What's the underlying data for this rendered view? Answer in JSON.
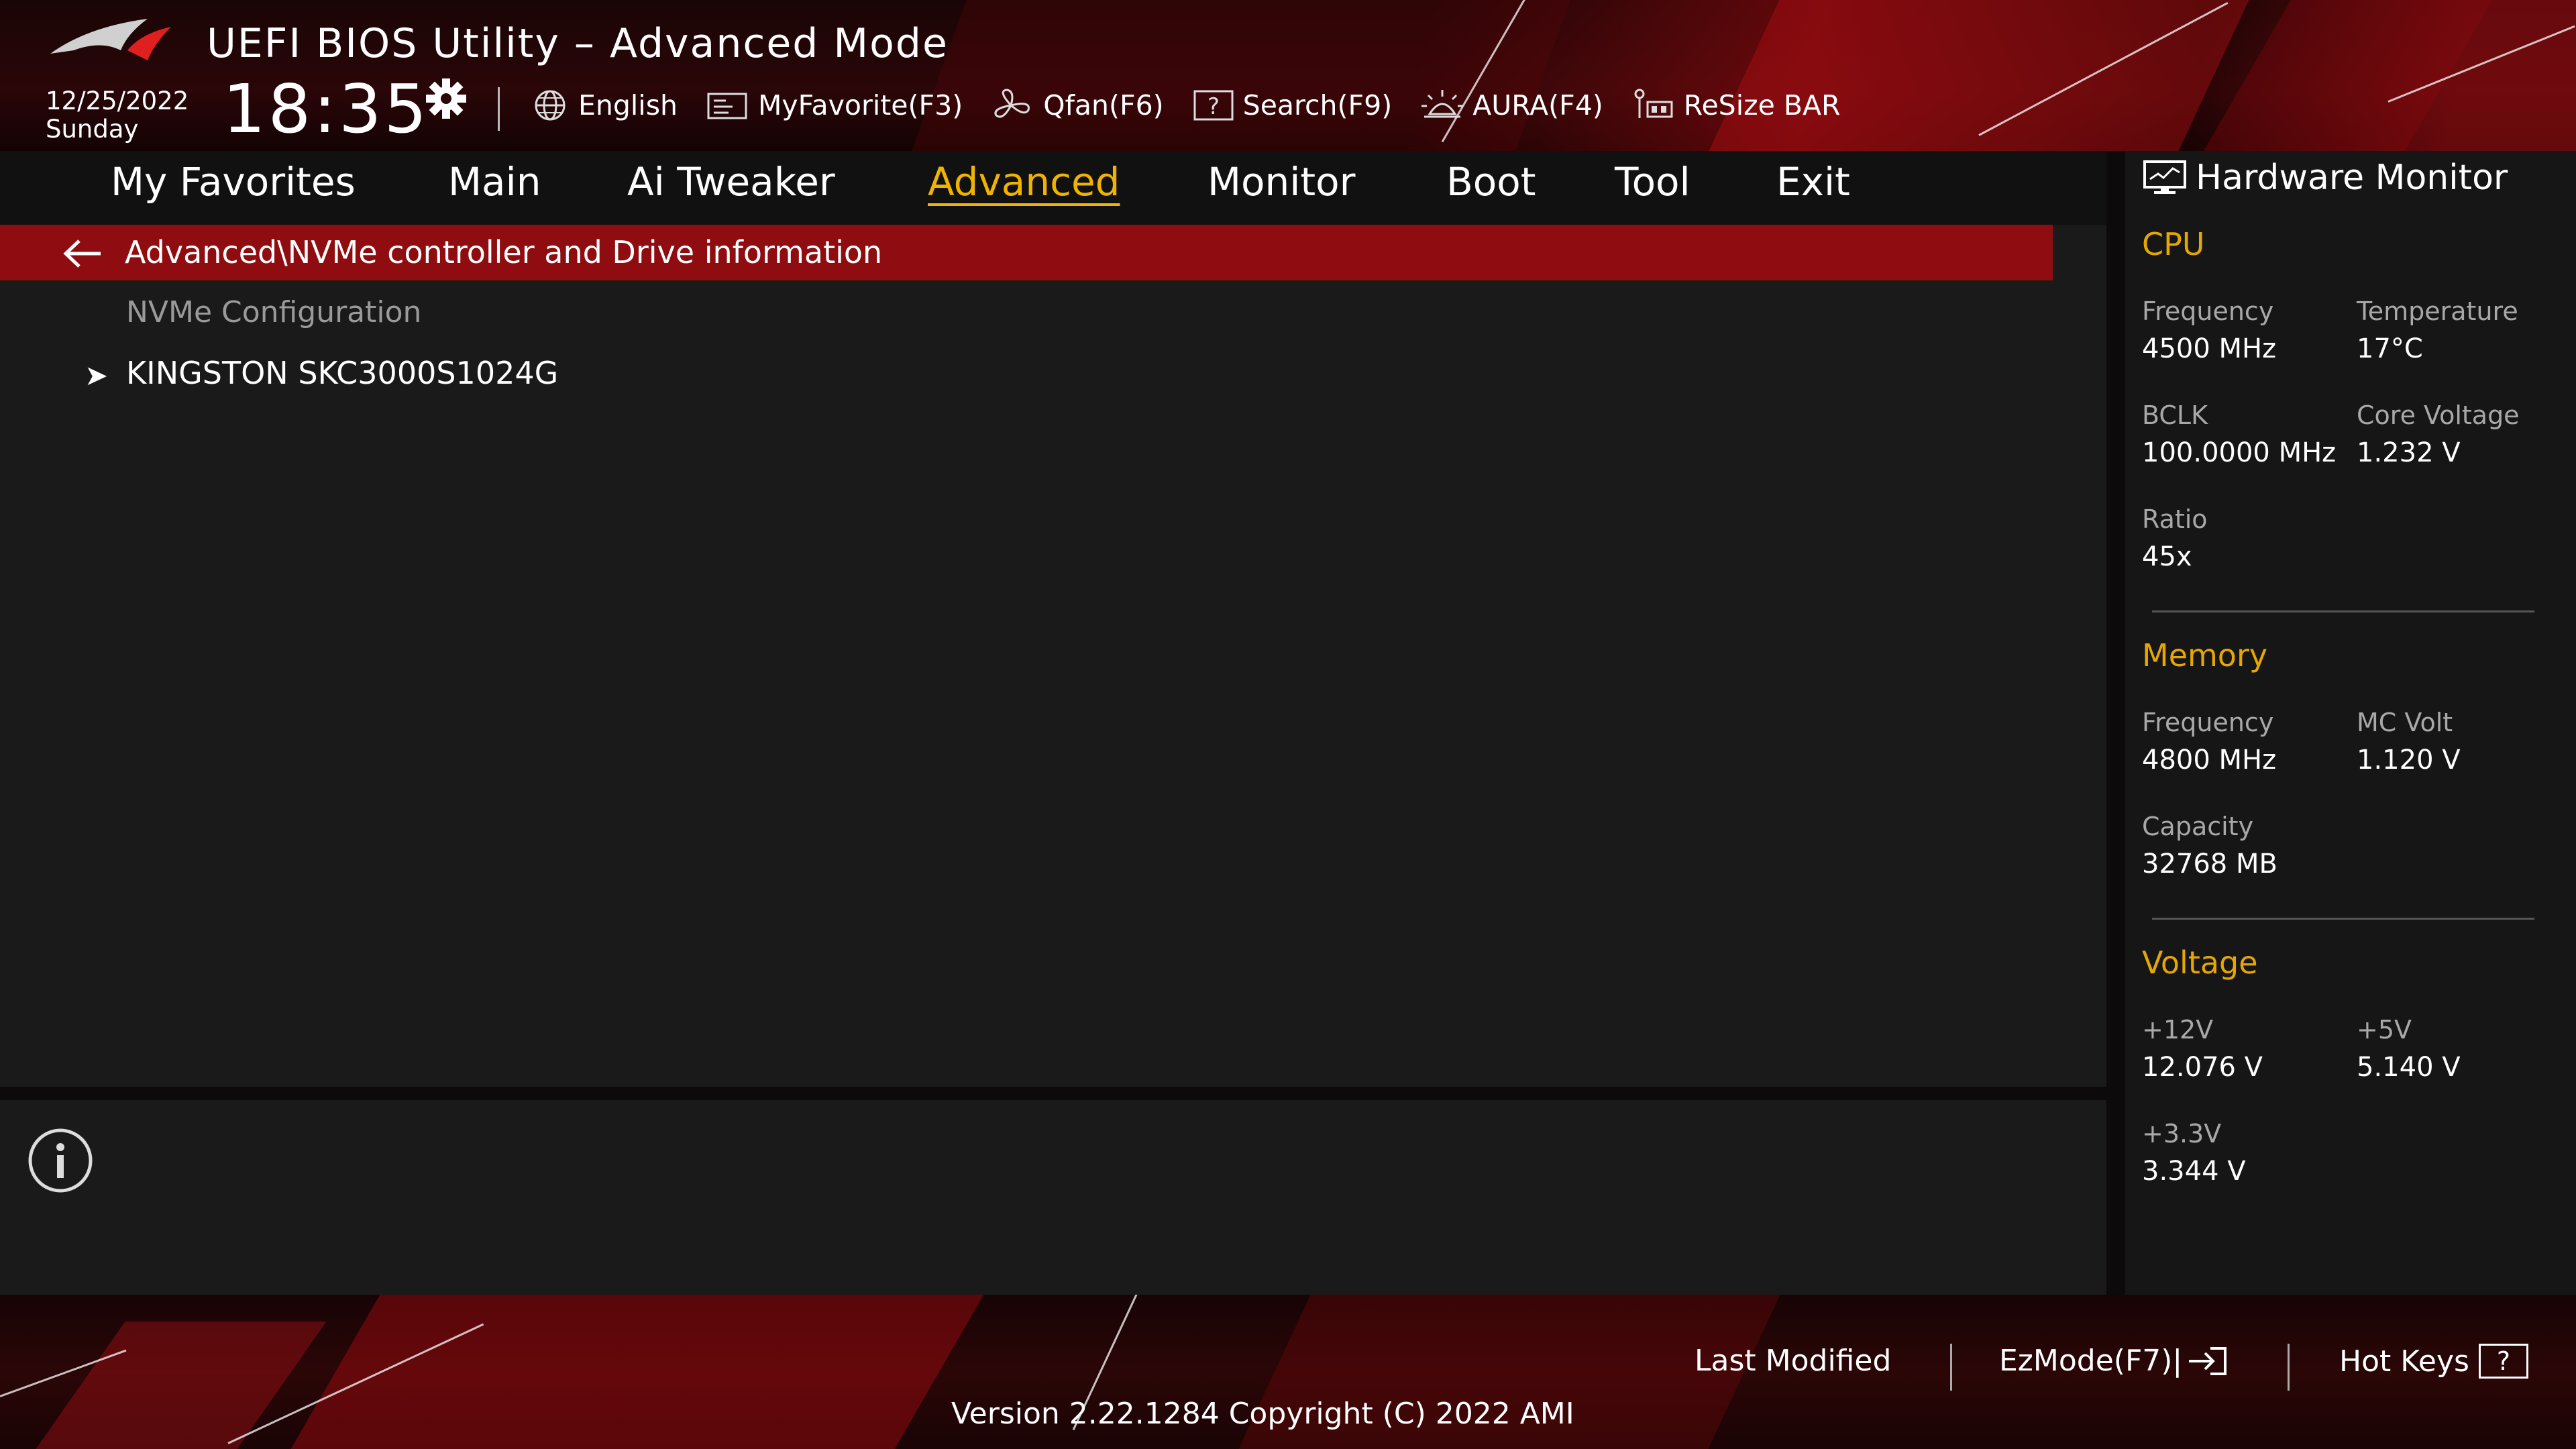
{
  "header": {
    "title": "UEFI BIOS Utility – Advanced Mode",
    "date": "12/25/2022",
    "weekday": "Sunday",
    "time": "18:35"
  },
  "toolbar": [
    {
      "label": "English",
      "icon": "globe-icon"
    },
    {
      "label": "MyFavorite(F3)",
      "icon": "favorite-icon"
    },
    {
      "label": "Qfan(F6)",
      "icon": "fan-icon"
    },
    {
      "label": "Search(F9)",
      "icon": "search-help-icon"
    },
    {
      "label": "AURA(F4)",
      "icon": "aura-icon"
    },
    {
      "label": "ReSize BAR",
      "icon": "resize-bar-icon"
    }
  ],
  "nav": {
    "tabs": [
      "My Favorites",
      "Main",
      "Ai Tweaker",
      "Advanced",
      "Monitor",
      "Boot",
      "Tool",
      "Exit"
    ],
    "active": "Advanced"
  },
  "main": {
    "breadcrumb": "Advanced\\NVMe controller and Drive information",
    "section_label": "NVMe Configuration",
    "items": [
      {
        "label": "KINGSTON SKC3000S1024G"
      }
    ]
  },
  "hw_monitor": {
    "title": "Hardware Monitor",
    "cpu": {
      "title": "CPU",
      "frequency_label": "Frequency",
      "frequency": "4500 MHz",
      "temperature_label": "Temperature",
      "temperature": "17°C",
      "bclk_label": "BCLK",
      "bclk": "100.0000 MHz",
      "core_voltage_label": "Core Voltage",
      "core_voltage": "1.232 V",
      "ratio_label": "Ratio",
      "ratio": "45x"
    },
    "memory": {
      "title": "Memory",
      "frequency_label": "Frequency",
      "frequency": "4800 MHz",
      "mc_volt_label": "MC Volt",
      "mc_volt": "1.120 V",
      "capacity_label": "Capacity",
      "capacity": "32768 MB"
    },
    "voltage": {
      "title": "Voltage",
      "v12_label": "+12V",
      "v12": "12.076 V",
      "v5_label": "+5V",
      "v5": "5.140 V",
      "v33_label": "+3.3V",
      "v33": "3.344 V"
    }
  },
  "footer": {
    "last_modified": "Last Modified",
    "ezmode": "EzMode(F7)|",
    "hot_keys": "Hot Keys",
    "hot_keys_glyph": "?",
    "version": "Version 2.22.1284 Copyright (C) 2022 AMI"
  },
  "colors": {
    "accent_yellow": "#f0b400",
    "section_gold": "#e6a800",
    "breadcrumb_red": "#8f0d10"
  }
}
